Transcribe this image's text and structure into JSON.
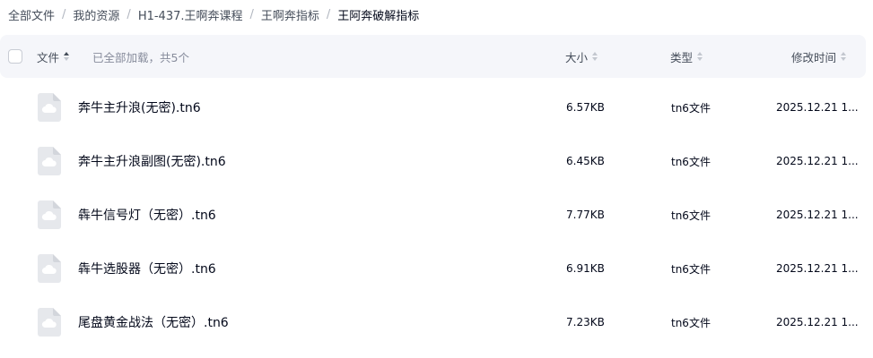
{
  "breadcrumb": [
    "全部文件",
    "我的资源",
    "H1-437.王啊奔课程",
    "王啊奔指标",
    "王阿奔破解指标"
  ],
  "header": {
    "name_label": "文件",
    "loaded_text": "已全部加载，共5个",
    "size_label": "大小",
    "type_label": "类型",
    "time_label": "修改时间"
  },
  "files": [
    {
      "name": "奔牛主升浪(无密).tn6",
      "size": "6.57KB",
      "type": "tn6文件",
      "time": "2025.12.21 1..."
    },
    {
      "name": "奔牛主升浪副图(无密).tn6",
      "size": "6.45KB",
      "type": "tn6文件",
      "time": "2025.12.21 1..."
    },
    {
      "name": "犇牛信号灯（无密）.tn6",
      "size": "7.77KB",
      "type": "tn6文件",
      "time": "2025.12.21 1..."
    },
    {
      "name": "犇牛选股器（无密）.tn6",
      "size": "6.91KB",
      "type": "tn6文件",
      "time": "2025.12.21 1..."
    },
    {
      "name": "尾盘黄金战法（无密）.tn6",
      "size": "7.23KB",
      "type": "tn6文件",
      "time": "2025.12.21 1..."
    }
  ],
  "icons": {
    "file": "cloud-file-icon",
    "sort": "sort-caret-icon"
  },
  "colors": {
    "header_bg": "#f5f6fa",
    "text": "#03081a",
    "muted": "#878c9c"
  }
}
